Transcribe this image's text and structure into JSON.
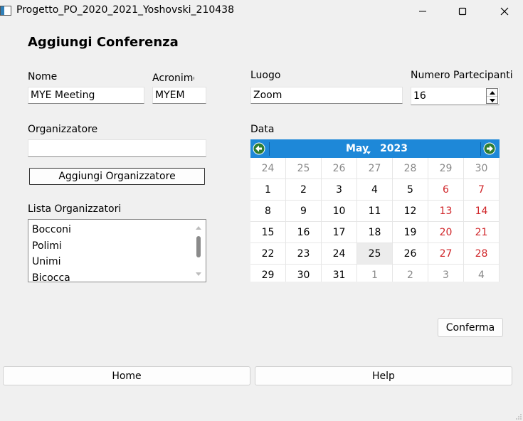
{
  "window": {
    "title": "Progetto_PO_2020_2021_Yoshovski_210438"
  },
  "page": {
    "heading": "Aggiungi Conferenza"
  },
  "form": {
    "nome_label": "Nome",
    "nome_value": "MYE Meeting",
    "acronimo_label": "Acronimo",
    "acronimo_value": "MYEM",
    "luogo_label": "Luogo",
    "luogo_value": "Zoom",
    "partecipanti_label": "Numero Partecipanti",
    "partecipanti_value": "16",
    "organizzatore_label": "Organizzatore",
    "organizzatore_value": "",
    "aggiungi_button": "Aggiungi Organizzatore",
    "lista_label": "Lista Organizzatori",
    "data_label": "Data",
    "conferma_button": "Conferma"
  },
  "organizers": [
    "Bocconi",
    "Polimi",
    "Unimi",
    "Bicocca"
  ],
  "calendar": {
    "month": "May",
    "year": "2023",
    "selected_day": "25",
    "weeks": [
      [
        "24",
        "25",
        "26",
        "27",
        "28",
        "29",
        "30"
      ],
      [
        "1",
        "2",
        "3",
        "4",
        "5",
        "6",
        "7"
      ],
      [
        "8",
        "9",
        "10",
        "11",
        "12",
        "13",
        "14"
      ],
      [
        "15",
        "16",
        "17",
        "18",
        "19",
        "20",
        "21"
      ],
      [
        "22",
        "23",
        "24",
        "25",
        "26",
        "27",
        "28"
      ],
      [
        "29",
        "30",
        "31",
        "1",
        "2",
        "3",
        "4"
      ]
    ],
    "other_month_cells": [
      [
        0,
        0
      ],
      [
        0,
        1
      ],
      [
        0,
        2
      ],
      [
        0,
        3
      ],
      [
        0,
        4
      ],
      [
        0,
        5
      ],
      [
        0,
        6
      ],
      [
        5,
        3
      ],
      [
        5,
        4
      ],
      [
        5,
        5
      ],
      [
        5,
        6
      ]
    ],
    "header_color": "#1e88d8",
    "weekend_color": "#d0262a"
  },
  "nav": {
    "home": "Home",
    "help": "Help"
  },
  "icons": {
    "app": "app-window-icon",
    "minimize": "minimize-icon",
    "maximize": "maximize-icon",
    "close": "close-icon",
    "prev": "arrow-left-circle-icon",
    "next": "arrow-right-circle-icon"
  }
}
